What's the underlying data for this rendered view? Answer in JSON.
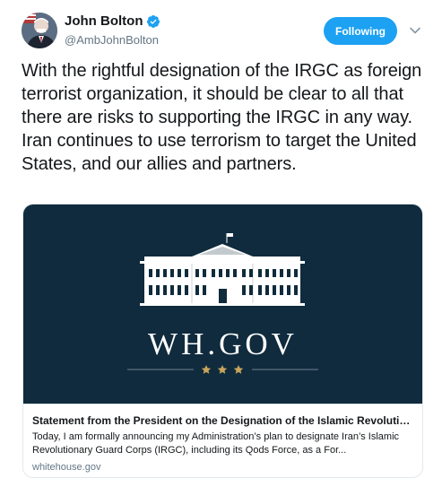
{
  "author": {
    "display_name": "John Bolton",
    "handle": "@AmbJohnBolton",
    "avatar_icon": "profile-photo",
    "verified_icon": "verified-badge-icon"
  },
  "header": {
    "follow_label": "Following",
    "caret_icon": "chevron-down-icon"
  },
  "tweet": {
    "text": "With the rightful designation of the IRGC as foreign terrorist organization, it should be clear to all that there are risks to supporting the IRGC in any way. Iran continues to use terrorism to target the United States, and our allies and partners."
  },
  "card": {
    "image_logo_text": "WH.GOV",
    "title": "Statement from the President on the Designation of the Islamic Revolution…",
    "description": "Today, I am formally announcing my Administration’s plan to designate Iran’s Islamic Revolutionary Guard Corps (IRGC), including its Qods Force, as a For...",
    "domain": "whitehouse.gov"
  },
  "colors": {
    "accent": "#1da1f2",
    "card_image_bg": "#0f2b3d",
    "star_gold": "#c9a45c"
  }
}
